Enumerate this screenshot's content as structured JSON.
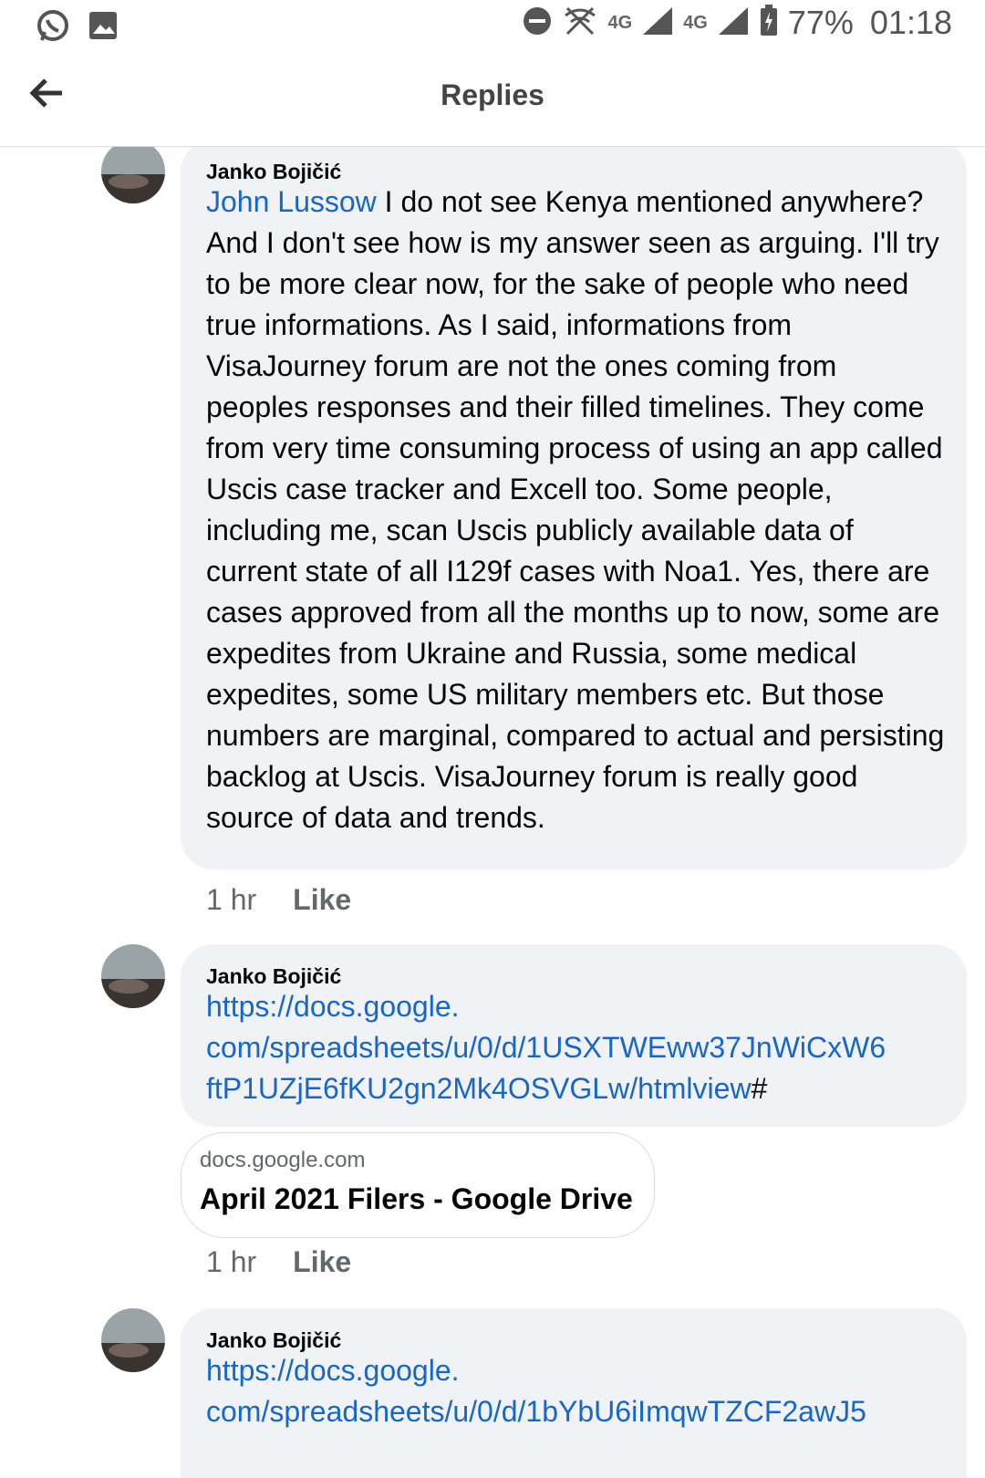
{
  "status_bar": {
    "battery": "77%",
    "time": "01:18",
    "network_primary": "4G",
    "network_secondary": "4G"
  },
  "header": {
    "title": "Replies"
  },
  "comments": [
    {
      "author": "Janko Bojičić",
      "mention": "John Lussow",
      "text": " I do not see Kenya mentioned anywhere?  And I don't see how is my answer seen as arguing. I'll try to be more clear now, for the sake of people who need true informations. As I said, informations from VisaJourney forum are not the ones coming from peoples responses and their filled timelines. They come from very time consuming process of using an app called Uscis case tracker and Excell too. Some people, including me, scan Uscis publicly available data of current state of all I129f cases with Noa1. Yes, there are cases approved from all the months up to now, some are expedites from Ukraine and Russia, some medical expedites, some US military members etc. But those numbers are marginal, compared to actual and persisting backlog at Uscis. VisaJourney forum is really good source of data and trends.",
      "time": "1 hr",
      "like": "Like"
    },
    {
      "author": "Janko Bojičić",
      "link_lines": [
        "https://docs.google.",
        "com/spreadsheets/u/0/d/1USXTWEww37JnWiCxW6",
        "ftP1UZjE6fKU2gn2Mk4OSVGLw/htmlview"
      ],
      "link_suffix": "#",
      "preview_domain": "docs.google.com",
      "preview_title": "April 2021 Filers - Google Drive",
      "time": "1 hr",
      "like": "Like"
    },
    {
      "author": "Janko Bojičić",
      "link_lines": [
        "https://docs.google.",
        "com/spreadsheets/u/0/d/1bYbU6iImqwTZCF2awJ5"
      ]
    }
  ],
  "icons": [
    "whatsapp-icon",
    "gallery-icon",
    "dnd-icon",
    "wifi-off-icon",
    "signal-icon",
    "battery-icon",
    "back-arrow-icon"
  ]
}
